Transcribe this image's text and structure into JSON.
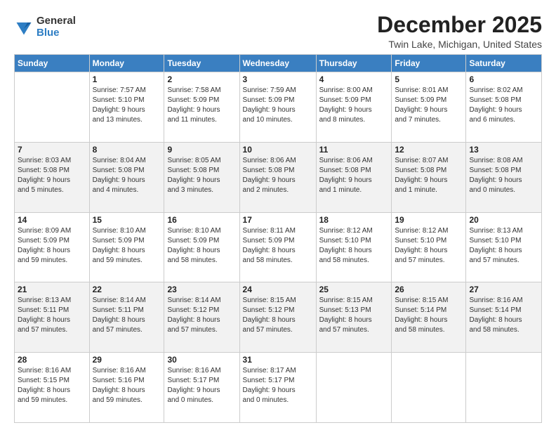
{
  "logo": {
    "general": "General",
    "blue": "Blue"
  },
  "title": "December 2025",
  "location": "Twin Lake, Michigan, United States",
  "days_header": [
    "Sunday",
    "Monday",
    "Tuesday",
    "Wednesday",
    "Thursday",
    "Friday",
    "Saturday"
  ],
  "weeks": [
    [
      {
        "day": "",
        "info": ""
      },
      {
        "day": "1",
        "info": "Sunrise: 7:57 AM\nSunset: 5:10 PM\nDaylight: 9 hours\nand 13 minutes."
      },
      {
        "day": "2",
        "info": "Sunrise: 7:58 AM\nSunset: 5:09 PM\nDaylight: 9 hours\nand 11 minutes."
      },
      {
        "day": "3",
        "info": "Sunrise: 7:59 AM\nSunset: 5:09 PM\nDaylight: 9 hours\nand 10 minutes."
      },
      {
        "day": "4",
        "info": "Sunrise: 8:00 AM\nSunset: 5:09 PM\nDaylight: 9 hours\nand 8 minutes."
      },
      {
        "day": "5",
        "info": "Sunrise: 8:01 AM\nSunset: 5:09 PM\nDaylight: 9 hours\nand 7 minutes."
      },
      {
        "day": "6",
        "info": "Sunrise: 8:02 AM\nSunset: 5:08 PM\nDaylight: 9 hours\nand 6 minutes."
      }
    ],
    [
      {
        "day": "7",
        "info": "Sunrise: 8:03 AM\nSunset: 5:08 PM\nDaylight: 9 hours\nand 5 minutes."
      },
      {
        "day": "8",
        "info": "Sunrise: 8:04 AM\nSunset: 5:08 PM\nDaylight: 9 hours\nand 4 minutes."
      },
      {
        "day": "9",
        "info": "Sunrise: 8:05 AM\nSunset: 5:08 PM\nDaylight: 9 hours\nand 3 minutes."
      },
      {
        "day": "10",
        "info": "Sunrise: 8:06 AM\nSunset: 5:08 PM\nDaylight: 9 hours\nand 2 minutes."
      },
      {
        "day": "11",
        "info": "Sunrise: 8:06 AM\nSunset: 5:08 PM\nDaylight: 9 hours\nand 1 minute."
      },
      {
        "day": "12",
        "info": "Sunrise: 8:07 AM\nSunset: 5:08 PM\nDaylight: 9 hours\nand 1 minute."
      },
      {
        "day": "13",
        "info": "Sunrise: 8:08 AM\nSunset: 5:08 PM\nDaylight: 9 hours\nand 0 minutes."
      }
    ],
    [
      {
        "day": "14",
        "info": "Sunrise: 8:09 AM\nSunset: 5:09 PM\nDaylight: 8 hours\nand 59 minutes."
      },
      {
        "day": "15",
        "info": "Sunrise: 8:10 AM\nSunset: 5:09 PM\nDaylight: 8 hours\nand 59 minutes."
      },
      {
        "day": "16",
        "info": "Sunrise: 8:10 AM\nSunset: 5:09 PM\nDaylight: 8 hours\nand 58 minutes."
      },
      {
        "day": "17",
        "info": "Sunrise: 8:11 AM\nSunset: 5:09 PM\nDaylight: 8 hours\nand 58 minutes."
      },
      {
        "day": "18",
        "info": "Sunrise: 8:12 AM\nSunset: 5:10 PM\nDaylight: 8 hours\nand 58 minutes."
      },
      {
        "day": "19",
        "info": "Sunrise: 8:12 AM\nSunset: 5:10 PM\nDaylight: 8 hours\nand 57 minutes."
      },
      {
        "day": "20",
        "info": "Sunrise: 8:13 AM\nSunset: 5:10 PM\nDaylight: 8 hours\nand 57 minutes."
      }
    ],
    [
      {
        "day": "21",
        "info": "Sunrise: 8:13 AM\nSunset: 5:11 PM\nDaylight: 8 hours\nand 57 minutes."
      },
      {
        "day": "22",
        "info": "Sunrise: 8:14 AM\nSunset: 5:11 PM\nDaylight: 8 hours\nand 57 minutes."
      },
      {
        "day": "23",
        "info": "Sunrise: 8:14 AM\nSunset: 5:12 PM\nDaylight: 8 hours\nand 57 minutes."
      },
      {
        "day": "24",
        "info": "Sunrise: 8:15 AM\nSunset: 5:12 PM\nDaylight: 8 hours\nand 57 minutes."
      },
      {
        "day": "25",
        "info": "Sunrise: 8:15 AM\nSunset: 5:13 PM\nDaylight: 8 hours\nand 57 minutes."
      },
      {
        "day": "26",
        "info": "Sunrise: 8:15 AM\nSunset: 5:14 PM\nDaylight: 8 hours\nand 58 minutes."
      },
      {
        "day": "27",
        "info": "Sunrise: 8:16 AM\nSunset: 5:14 PM\nDaylight: 8 hours\nand 58 minutes."
      }
    ],
    [
      {
        "day": "28",
        "info": "Sunrise: 8:16 AM\nSunset: 5:15 PM\nDaylight: 8 hours\nand 59 minutes."
      },
      {
        "day": "29",
        "info": "Sunrise: 8:16 AM\nSunset: 5:16 PM\nDaylight: 8 hours\nand 59 minutes."
      },
      {
        "day": "30",
        "info": "Sunrise: 8:16 AM\nSunset: 5:17 PM\nDaylight: 9 hours\nand 0 minutes."
      },
      {
        "day": "31",
        "info": "Sunrise: 8:17 AM\nSunset: 5:17 PM\nDaylight: 9 hours\nand 0 minutes."
      },
      {
        "day": "",
        "info": ""
      },
      {
        "day": "",
        "info": ""
      },
      {
        "day": "",
        "info": ""
      }
    ]
  ]
}
